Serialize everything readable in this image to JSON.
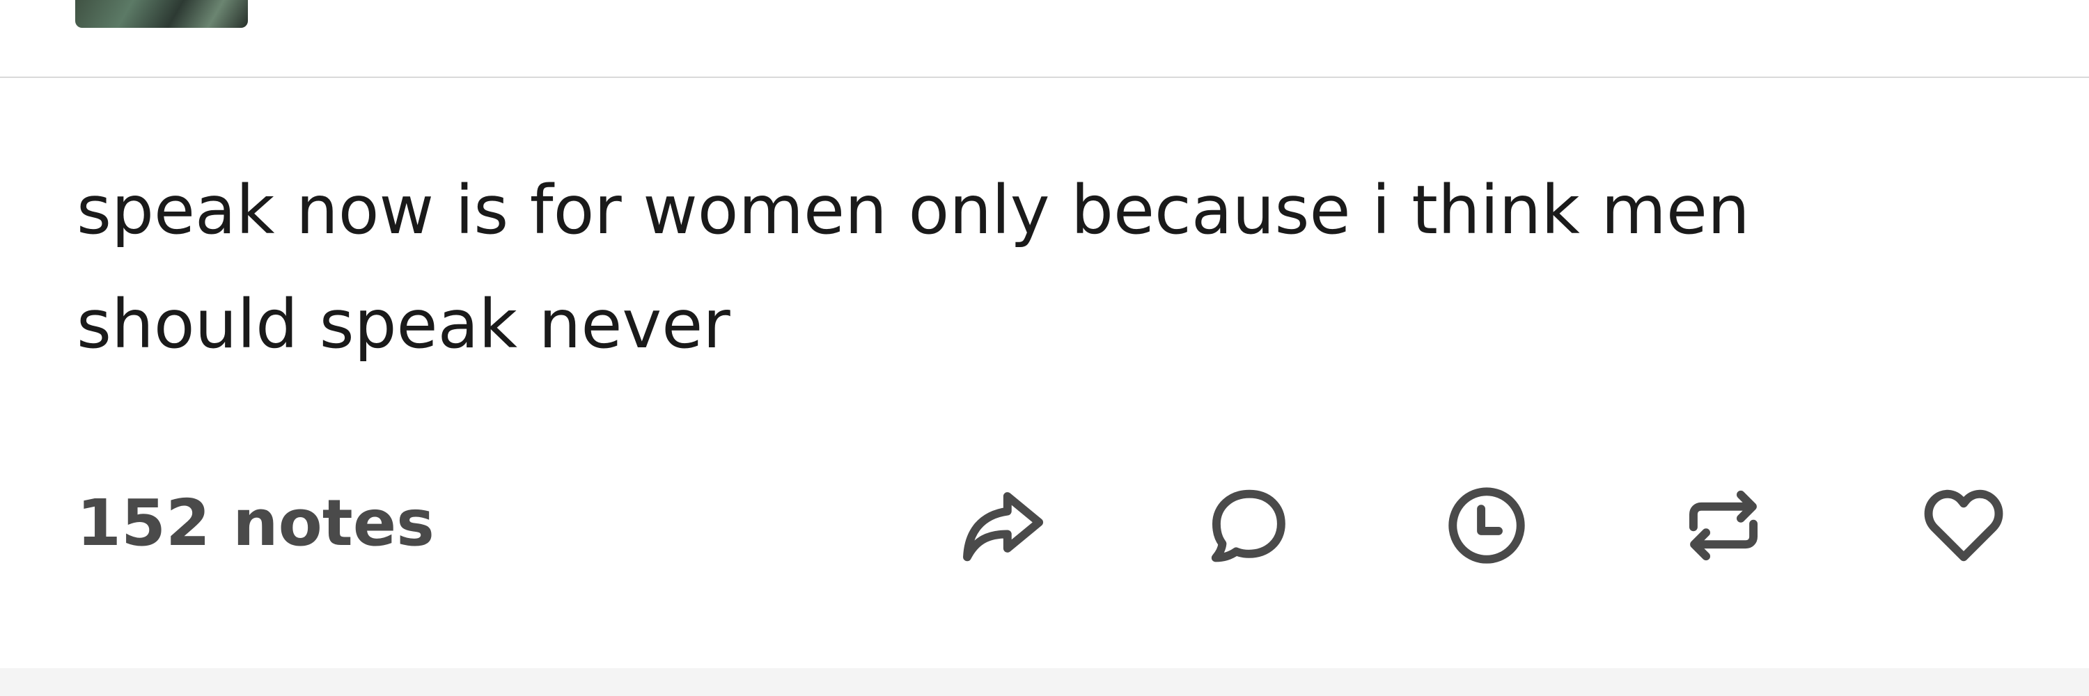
{
  "post": {
    "text_line1": "speak now is for women only because i think men",
    "text_line2": "should speak never"
  },
  "footer": {
    "notes_label": "152 notes",
    "actions": [
      {
        "name": "share",
        "icon": "share-icon"
      },
      {
        "name": "reply",
        "icon": "comment-icon"
      },
      {
        "name": "queue",
        "icon": "clock-icon"
      },
      {
        "name": "reblog",
        "icon": "reblog-icon"
      },
      {
        "name": "like",
        "icon": "heart-icon"
      }
    ]
  },
  "colors": {
    "text": "#1a1a1a",
    "notes": "#4a4a4a",
    "icon_stroke": "#4a4a4a",
    "divider": "#d9d9d9",
    "background": "#ffffff"
  }
}
